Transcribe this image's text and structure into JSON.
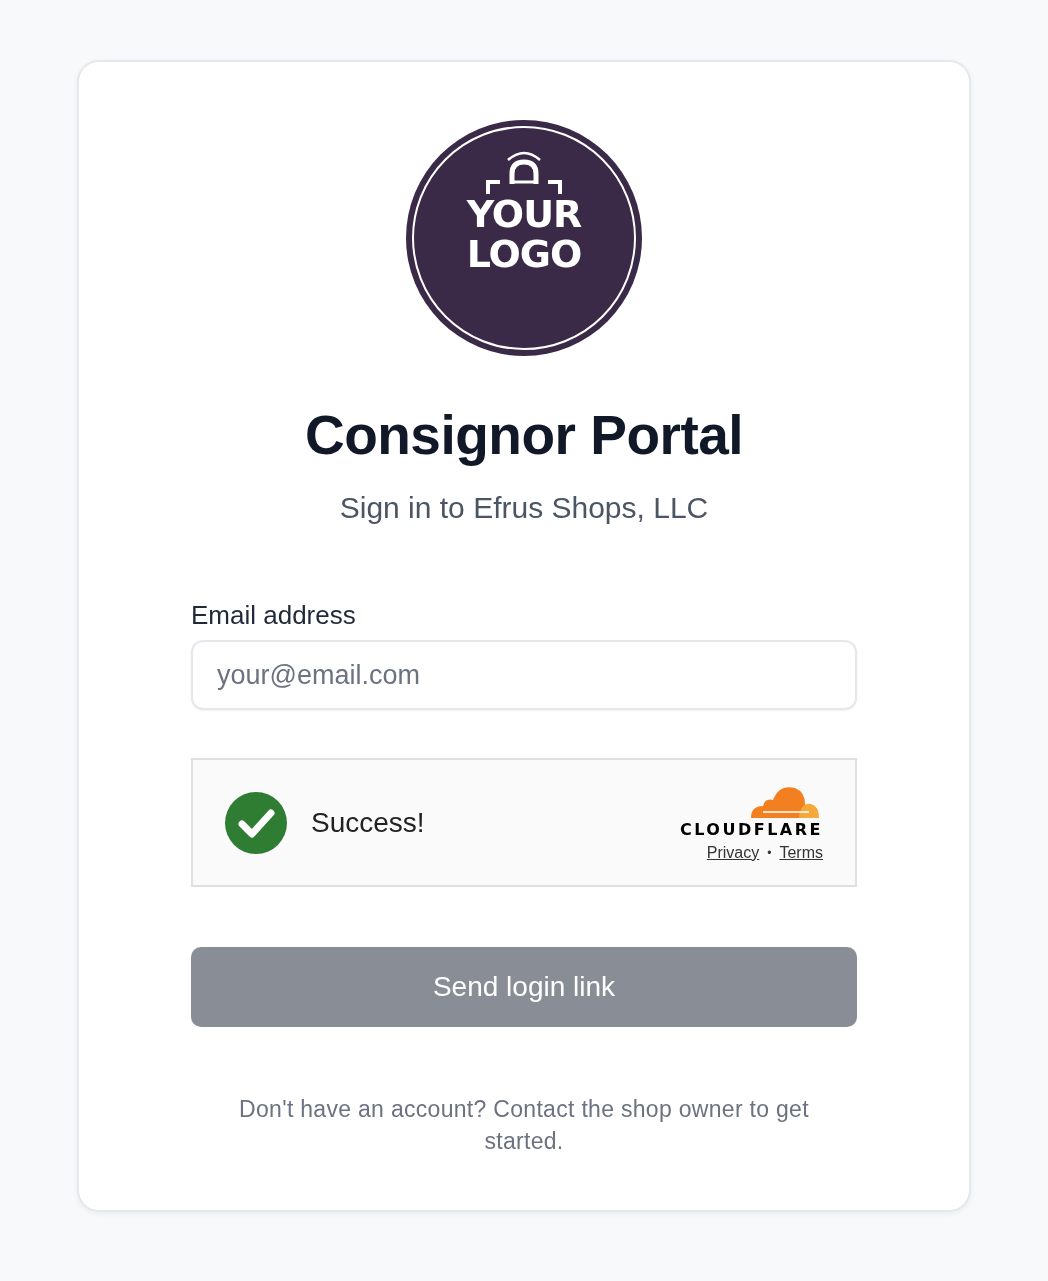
{
  "logo": {
    "lines": [
      "YOUR",
      "LOGO"
    ]
  },
  "title": "Consignor Portal",
  "subtitle": "Sign in to Efrus Shops, LLC",
  "email_field": {
    "label": "Email address",
    "placeholder": "your@email.com"
  },
  "captcha": {
    "verified": true,
    "status": "Success!",
    "brand": "CLOUDFLARE",
    "links": [
      "Privacy",
      "Terms"
    ],
    "separator": "•"
  },
  "submit_button": {
    "label": "Send login link",
    "disabled": true
  },
  "footer": "Don't have an account? Contact the shop owner to get started."
}
